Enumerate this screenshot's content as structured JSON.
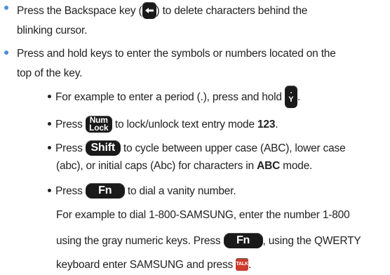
{
  "bullet1": {
    "before_key": "Press the Backspace key (",
    "after_key": ") to delete characters behind the",
    "line2": "blinking cursor."
  },
  "bullet2": {
    "line1": "Press and hold keys to enter the symbols or numbers located on the",
    "line2": "top of the key."
  },
  "sub1": {
    "text": "For example to enter a period (.), press and hold",
    "end": ".",
    "key_top": ".",
    "key_bottom": "Y"
  },
  "sub2": {
    "press": "Press",
    "key_line1": "Num",
    "key_line2": "Lock",
    "text": "to lock/unlock text entry mode",
    "mode": "123",
    "end": "."
  },
  "sub3": {
    "press": "Press",
    "key": "Shift",
    "text": "to cycle between upper case (ABC), lower case",
    "line2_before": "(abc), or initial caps (Abc) for characters in",
    "mode": "ABC",
    "line2_after": "mode."
  },
  "sub4": {
    "press": "Press",
    "key": "Fn",
    "text": "to dial a vanity number.",
    "para1": "For example to dial 1-800-SAMSUNG, enter the number 1-800",
    "para2_before": "using the gray numeric keys. Press",
    "para2_after": ", using the QWERTY",
    "para3_before": "keyboard enter SAMSUNG and press",
    "talk_key": "TALK",
    "para3_after": "."
  },
  "colors": {
    "bullet": "#4a90d6",
    "key": "#1a1a1a",
    "talk_key": "#cc3b2b"
  }
}
